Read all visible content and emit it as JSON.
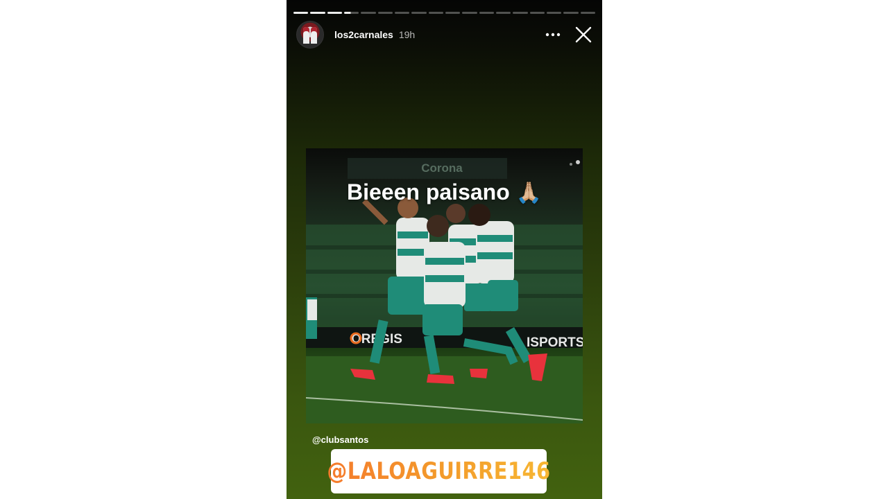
{
  "story": {
    "segments_total": 18,
    "segments_done": 3,
    "author": {
      "username": "los2carnales",
      "time_ago": "19h"
    },
    "caption": "Bieeen paisano",
    "caption_emoji": "🙏🏼",
    "mention_text": "@clubsantos",
    "mention_sticker": "@LALOAGUIRRE146"
  },
  "photo": {
    "banner_text": "Corona",
    "board_left": "OREGIS",
    "board_right": "ISPORTS",
    "accent_colors": {
      "kit_teal": "#1f8c78",
      "kit_white": "#e6e9e6",
      "boot_red": "#e8323c",
      "stadium_green": "#22442a",
      "pitch_green": "#2c5a1e"
    }
  },
  "icons": {
    "more": "more-horizontal-icon",
    "close": "close-icon"
  },
  "colors": {
    "sticker_gradient_start": "#f57a2c",
    "sticker_gradient_end": "#f7b733",
    "background_gradient_top": "#050505",
    "background_gradient_bottom": "#42620f"
  }
}
